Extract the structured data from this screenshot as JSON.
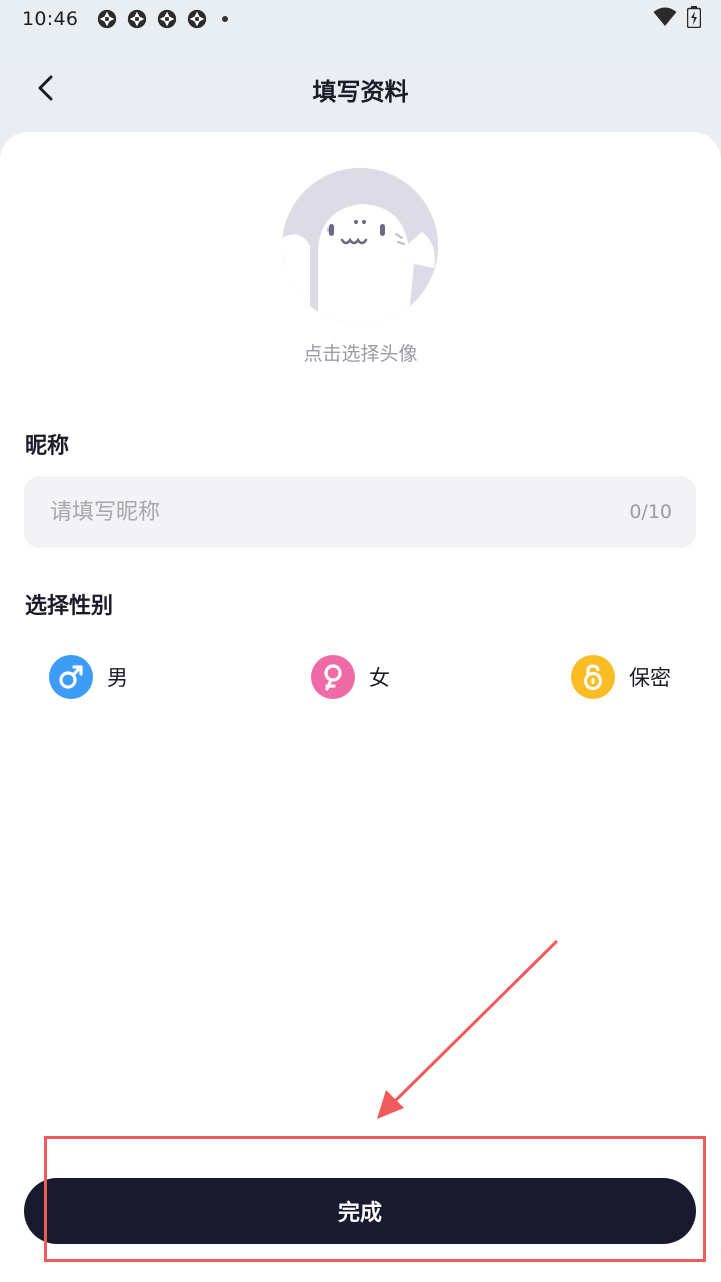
{
  "status_bar": {
    "time": "10:46",
    "notification_icons": [
      "aperture-icon",
      "aperture-icon",
      "aperture-icon",
      "aperture-icon"
    ],
    "right_icons": [
      "wifi-icon",
      "battery-icon"
    ]
  },
  "header": {
    "title": "填写资料",
    "back_icon": "chevron-left-icon"
  },
  "avatar": {
    "hint": "点击选择头像",
    "background_color": "#dcdbe6"
  },
  "nickname": {
    "label": "昵称",
    "placeholder": "请填写昵称",
    "value": "",
    "counter": "0/10"
  },
  "gender": {
    "label": "选择性别",
    "options": [
      {
        "label": "男",
        "icon": "male-icon",
        "color": "#3d9cf5"
      },
      {
        "label": "女",
        "icon": "female-icon",
        "color": "#f06aa8"
      },
      {
        "label": "保密",
        "icon": "lock-icon",
        "color": "#fbbd26"
      }
    ]
  },
  "done_button": {
    "label": "完成",
    "color": "#1a1a2e"
  },
  "annotation": {
    "color": "#ef5b5b"
  }
}
